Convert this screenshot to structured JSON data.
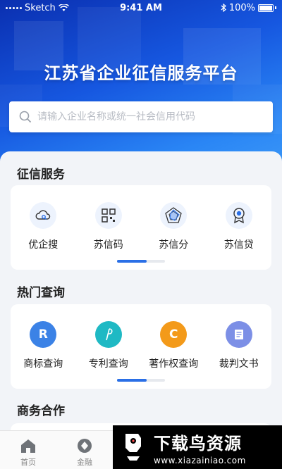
{
  "status_bar": {
    "carrier": "Sketch",
    "time": "9:41 AM",
    "battery": "100%"
  },
  "app_title": "江苏省企业征信服务平台",
  "search": {
    "placeholder": "请输入企业名称或统一社会信用代码",
    "value": ""
  },
  "sections": [
    {
      "title": "征信服务",
      "items": [
        {
          "label": "优企搜",
          "icon": "cloud-search-icon"
        },
        {
          "label": "苏信码",
          "icon": "qr-code-icon"
        },
        {
          "label": "苏信分",
          "icon": "radar-chart-icon"
        },
        {
          "label": "苏信贷",
          "icon": "medal-icon"
        }
      ],
      "pager": {
        "pages": 2,
        "active": 0
      }
    },
    {
      "title": "热门查询",
      "items": [
        {
          "label": "商标查询",
          "icon": "trademark-icon",
          "glyph": "R",
          "color": "#3b82e6"
        },
        {
          "label": "专利查询",
          "icon": "patent-icon",
          "glyph": "P",
          "color": "#1fb9c4"
        },
        {
          "label": "著作权查询",
          "icon": "copyright-icon",
          "glyph": "C",
          "color": "#f39a1a"
        },
        {
          "label": "裁判文书",
          "icon": "document-icon",
          "color": "#7c8fe6"
        }
      ],
      "pager": {
        "pages": 2,
        "active": 0
      }
    },
    {
      "title": "商务合作"
    }
  ],
  "tab_bar": [
    {
      "label": "首页",
      "icon": "home-icon",
      "active": true
    },
    {
      "label": "金融",
      "icon": "finance-icon",
      "active": false
    }
  ],
  "watermark": {
    "title": "下载鸟资源",
    "url": "www.xiazainiao.com"
  },
  "colors": {
    "primary": "#2a6fe6",
    "hero_start": "#0a2fb0",
    "hero_end": "#3a96f7"
  }
}
